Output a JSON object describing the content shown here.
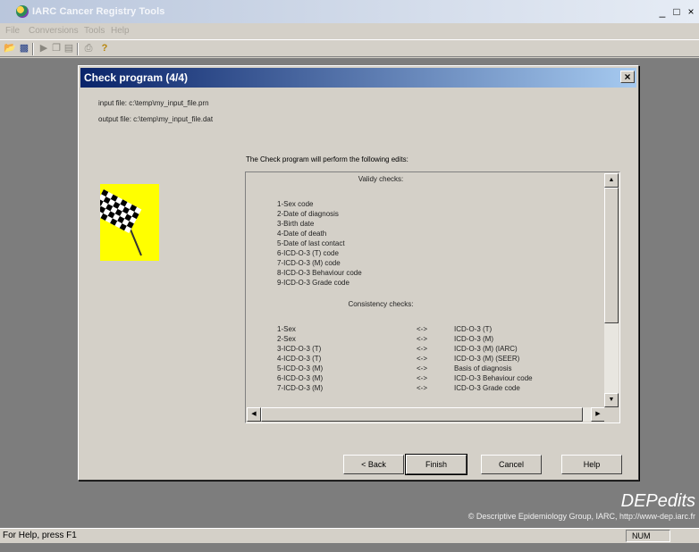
{
  "app": {
    "title": "IARC Cancer Registry Tools"
  },
  "window_controls": {
    "minimize": "_",
    "restore": "□",
    "close": "×"
  },
  "menu": [
    "File",
    "Conversions",
    "Tools",
    "Help"
  ],
  "toolbar_icons": [
    "open-folder-icon",
    "save-icon",
    "play-icon",
    "copy-icon",
    "paste-icon",
    "print-icon",
    "help-question-icon"
  ],
  "dialog": {
    "title": "Check program (4/4)",
    "close": "×",
    "input_file": "input file: c:\\temp\\my_input_file.prn",
    "output_file": "output file: c:\\temp\\my_input_file.dat",
    "intro": "The Check program will perform the following edits:",
    "validity_title": "Validy checks:",
    "validity_checks": [
      "1-Sex code",
      "2-Date of diagnosis",
      "3-Birth date",
      "4-Date of death",
      "5-Date of last contact",
      "6-ICD-O-3 (T) code",
      "7-ICD-O-3 (M) code",
      "8-ICD-O-3 Behaviour code",
      "9-ICD-O-3 Grade code"
    ],
    "consistency_title": "Consistency checks:",
    "consistency_checks": [
      {
        "left": "1-Sex",
        "arrow": "<->",
        "right": "ICD-O-3 (T)"
      },
      {
        "left": "2-Sex",
        "arrow": "<->",
        "right": "ICD-O-3 (M)"
      },
      {
        "left": "3-ICD-O-3 (T)",
        "arrow": "<->",
        "right": "ICD-O-3 (M) (IARC)"
      },
      {
        "left": "4-ICD-O-3 (T)",
        "arrow": "<->",
        "right": "ICD-O-3 (M) (SEER)"
      },
      {
        "left": "5-ICD-O-3 (M)",
        "arrow": "<->",
        "right": "Basis of diagnosis"
      },
      {
        "left": "6-ICD-O-3 (M)",
        "arrow": "<->",
        "right": "ICD-O-3 Behaviour code"
      },
      {
        "left": "7-ICD-O-3 (M)",
        "arrow": "<->",
        "right": "ICD-O-3 Grade code"
      }
    ],
    "buttons": {
      "back": "< Back",
      "finish": "Finish",
      "cancel": "Cancel",
      "help": "Help"
    }
  },
  "branding": {
    "logo": "DEPedits",
    "copyright": "© Descriptive Epidemiology Group, IARC, http://www-dep.iarc.fr"
  },
  "status": {
    "text": "For Help, press F1",
    "num": "NUM"
  }
}
